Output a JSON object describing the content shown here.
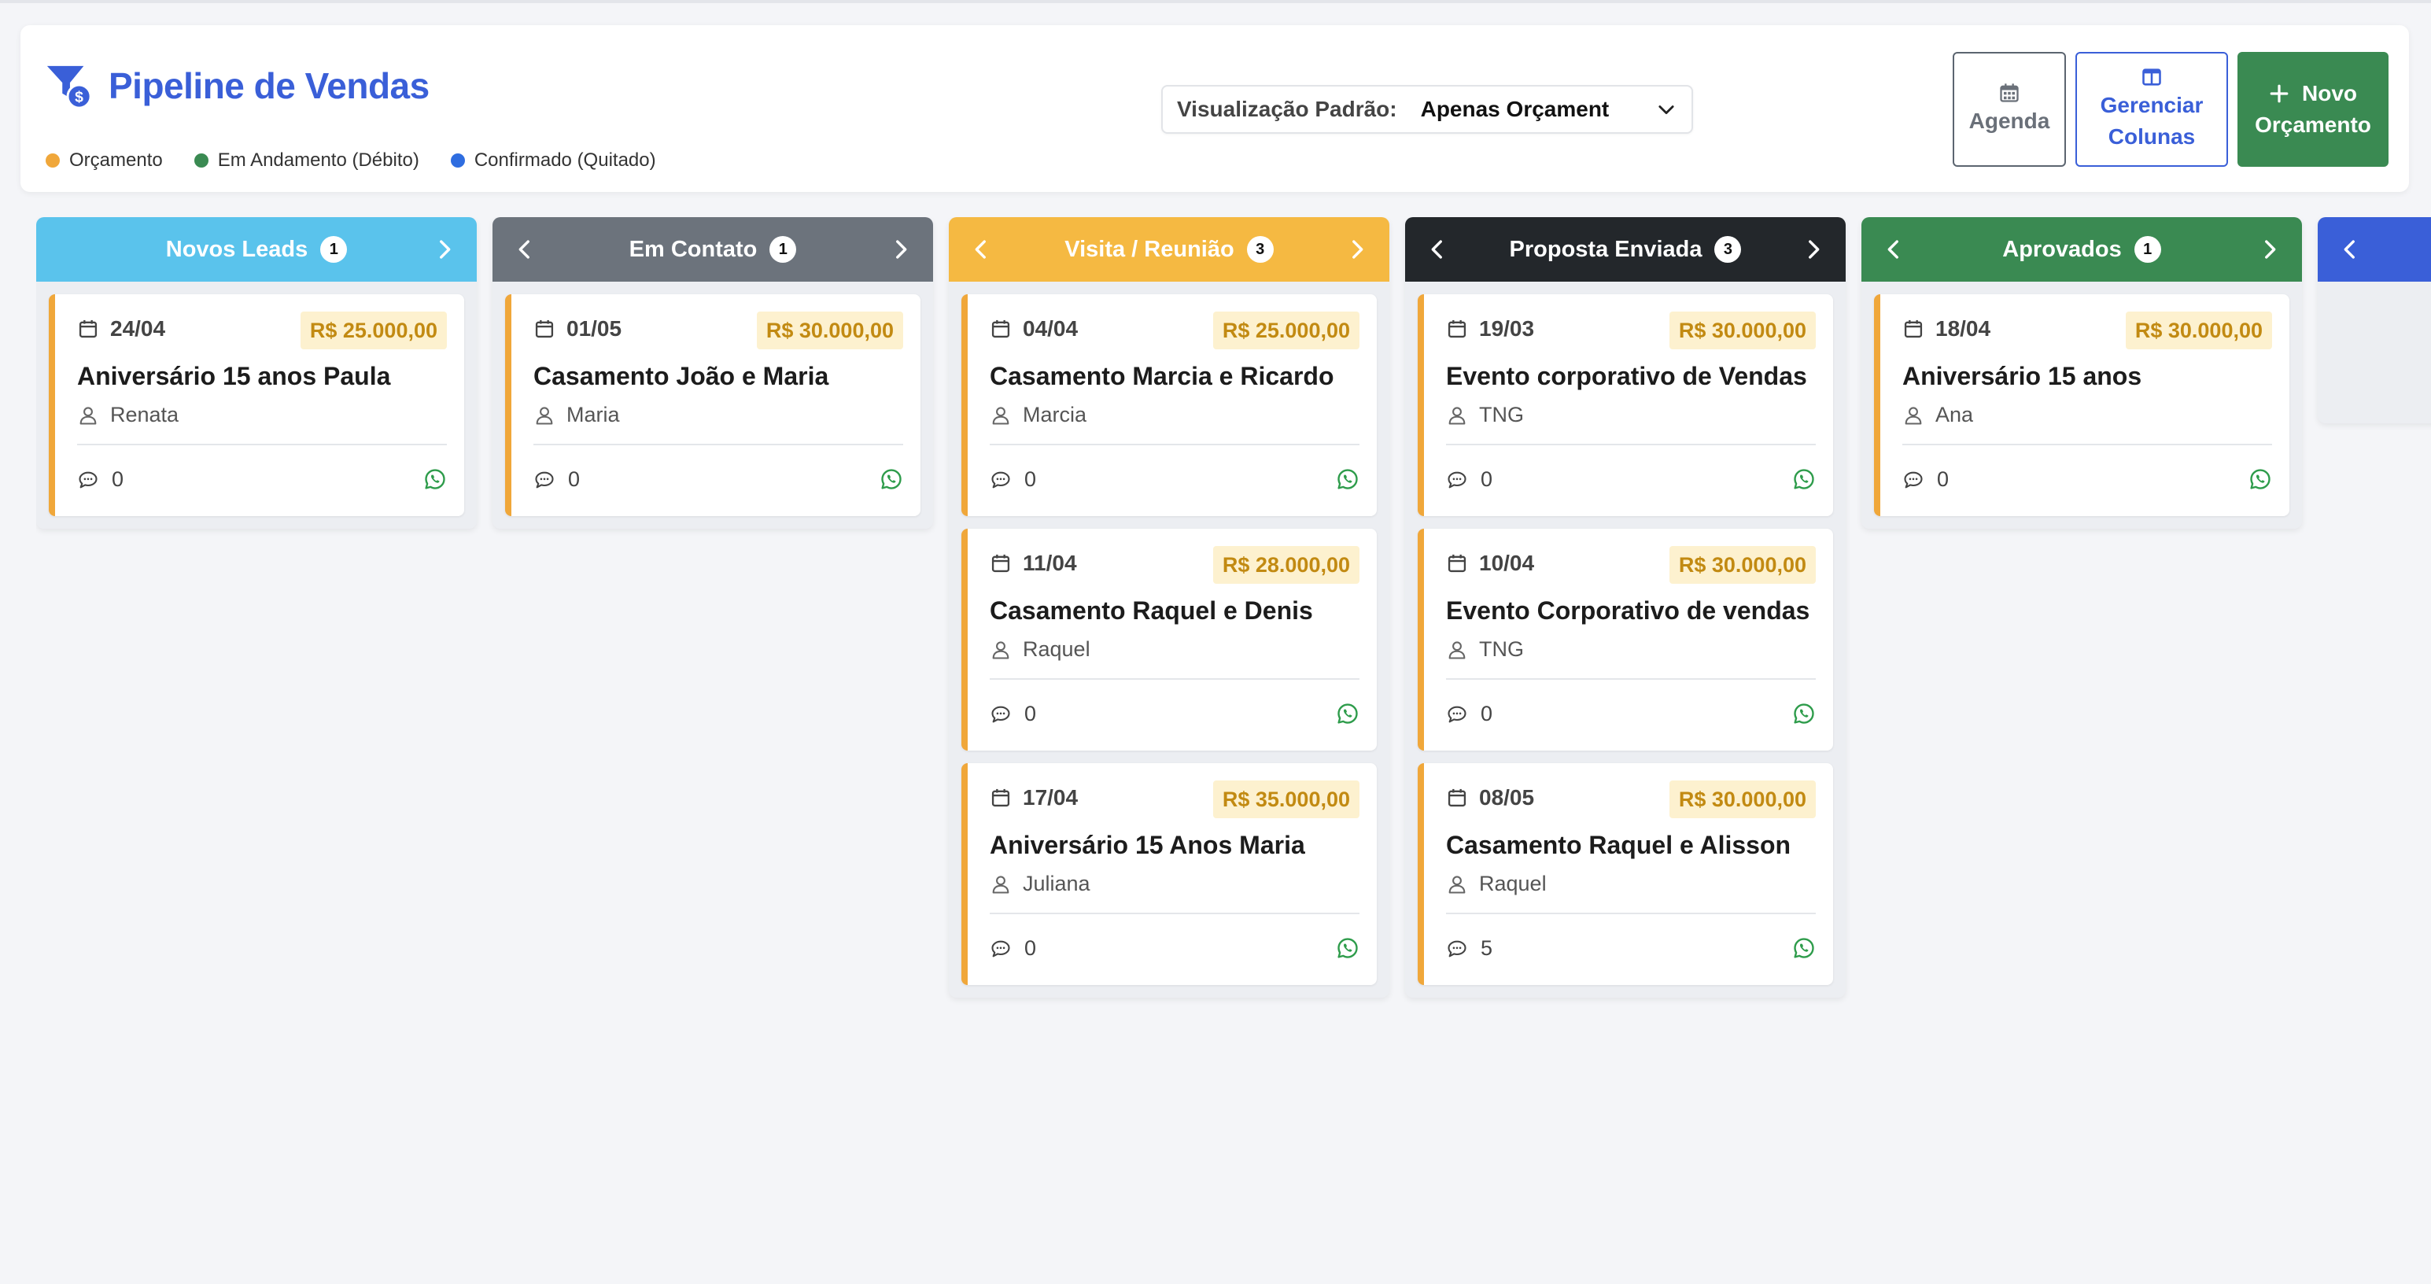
{
  "header": {
    "title": "Pipeline de Vendas",
    "title_icon": "funnel-dollar-icon",
    "legend": [
      {
        "label": "Orçamento",
        "color": "#f0a73a"
      },
      {
        "label": "Em Andamento (Débito)",
        "color": "#3a8a52"
      },
      {
        "label": "Confirmado (Quitado)",
        "color": "#2f6de0"
      }
    ],
    "view": {
      "label": "Visualização Padrão:",
      "value": "Apenas Orçament"
    },
    "buttons": {
      "agenda": "Agenda",
      "manage_columns_1": "Gerenciar",
      "manage_columns_2": "Colunas",
      "new_budget_1": "Novo",
      "new_budget_2": "Orçamento"
    }
  },
  "colors": {
    "accent": "#3a5fd8",
    "card_border": "#f0a73a",
    "value_badge_bg": "#fdf1cf",
    "value_badge_text": "#c28a12",
    "whatsapp": "#2e9c4b"
  },
  "columns": [
    {
      "name": "Novos Leads",
      "count": "1",
      "color": "#5ac3ec",
      "cards": [
        {
          "date": "24/04",
          "value": "R$ 25.000,00",
          "title": "Aniversário 15 anos Paula",
          "client": "Renata",
          "comments": "0"
        }
      ]
    },
    {
      "name": "Em Contato",
      "count": "1",
      "color": "#6c737c",
      "cards": [
        {
          "date": "01/05",
          "value": "R$ 30.000,00",
          "title": "Casamento João e Maria",
          "client": "Maria",
          "comments": "0"
        }
      ]
    },
    {
      "name": "Visita / Reunião",
      "count": "3",
      "color": "#f5b942",
      "cards": [
        {
          "date": "04/04",
          "value": "R$ 25.000,00",
          "title": "Casamento Marcia e Ricardo",
          "client": "Marcia",
          "comments": "0"
        },
        {
          "date": "11/04",
          "value": "R$ 28.000,00",
          "title": "Casamento Raquel e Denis",
          "client": "Raquel",
          "comments": "0"
        },
        {
          "date": "17/04",
          "value": "R$ 35.000,00",
          "title": "Aniversário 15 Anos Maria",
          "client": "Juliana",
          "comments": "0"
        }
      ]
    },
    {
      "name": "Proposta Enviada",
      "count": "3",
      "color": "#23272b",
      "cards": [
        {
          "date": "19/03",
          "value": "R$ 30.000,00",
          "title": "Evento corporativo de Vendas",
          "client": "TNG",
          "comments": "0"
        },
        {
          "date": "10/04",
          "value": "R$ 30.000,00",
          "title": "Evento Corporativo de vendas",
          "client": "TNG",
          "comments": "0"
        },
        {
          "date": "08/05",
          "value": "R$ 30.000,00",
          "title": "Casamento Raquel e Alisson",
          "client": "Raquel",
          "comments": "5"
        }
      ]
    },
    {
      "name": "Aprovados",
      "count": "1",
      "color": "#3a8a52",
      "cards": [
        {
          "date": "18/04",
          "value": "R$ 30.000,00",
          "title": "Aniversário 15 anos",
          "client": "Ana",
          "comments": "0"
        }
      ]
    },
    {
      "name": "",
      "count": "",
      "color": "#3a5fd8",
      "cards": []
    }
  ]
}
